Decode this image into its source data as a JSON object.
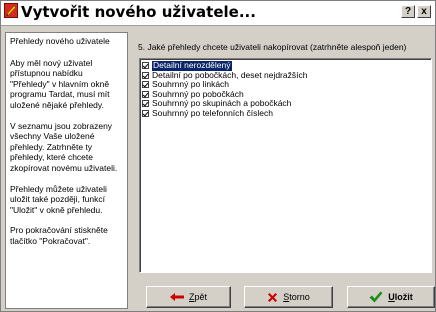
{
  "window": {
    "title": "Vytvořit nového uživatele...",
    "help_label": "?",
    "close_label": "x"
  },
  "side_panel": {
    "heading": "Přehledy nového uživatele",
    "paragraphs": [
      "Aby měl nový uživatel přístupnou nabídku \"Přehledy\" v hlavním okně programu Tardat, musí mít uložené nějaké přehledy.",
      "V seznamu jsou zobrazeny všechny Vaše uložené přehledy. Zatrhněte ty přehledy, které chcete zkopírovat novému uživateli.",
      "Přehledy můžete uživateli uložit také později, funkcí \"Uložit\" v okně přehledu.",
      "Pro pokračování stiskněte tlačítko \"Pokračovat\"."
    ]
  },
  "main": {
    "instruction": "5. Jaké přehledy chcete uživateli nakopírovat (zatrhněte alespoň jeden)",
    "reports": [
      {
        "label": "Detailní nerozdělený",
        "checked": true,
        "selected": true
      },
      {
        "label": "Detailní po pobočkách, deset nejdražších",
        "checked": true,
        "selected": false
      },
      {
        "label": "Souhrnný po linkách",
        "checked": true,
        "selected": false
      },
      {
        "label": "Souhrnný po pobočkách",
        "checked": true,
        "selected": false
      },
      {
        "label": "Souhrnný po skupinách a pobočkách",
        "checked": true,
        "selected": false
      },
      {
        "label": "Souhrnný po telefonních číslech",
        "checked": true,
        "selected": false
      }
    ]
  },
  "buttons": {
    "back": "Zpět",
    "cancel": "Storno",
    "save": "Uložit"
  },
  "colors": {
    "dialog_bg": "#d4d0c8",
    "selection": "#0a246a",
    "back_arrow": "#cc0000",
    "cancel_x": "#cc0000",
    "save_check": "#1a8f1a"
  },
  "icons": {
    "app": "app-icon",
    "back": "arrow-left-icon",
    "cancel": "red-x-icon",
    "save": "green-checkmark-icon"
  }
}
